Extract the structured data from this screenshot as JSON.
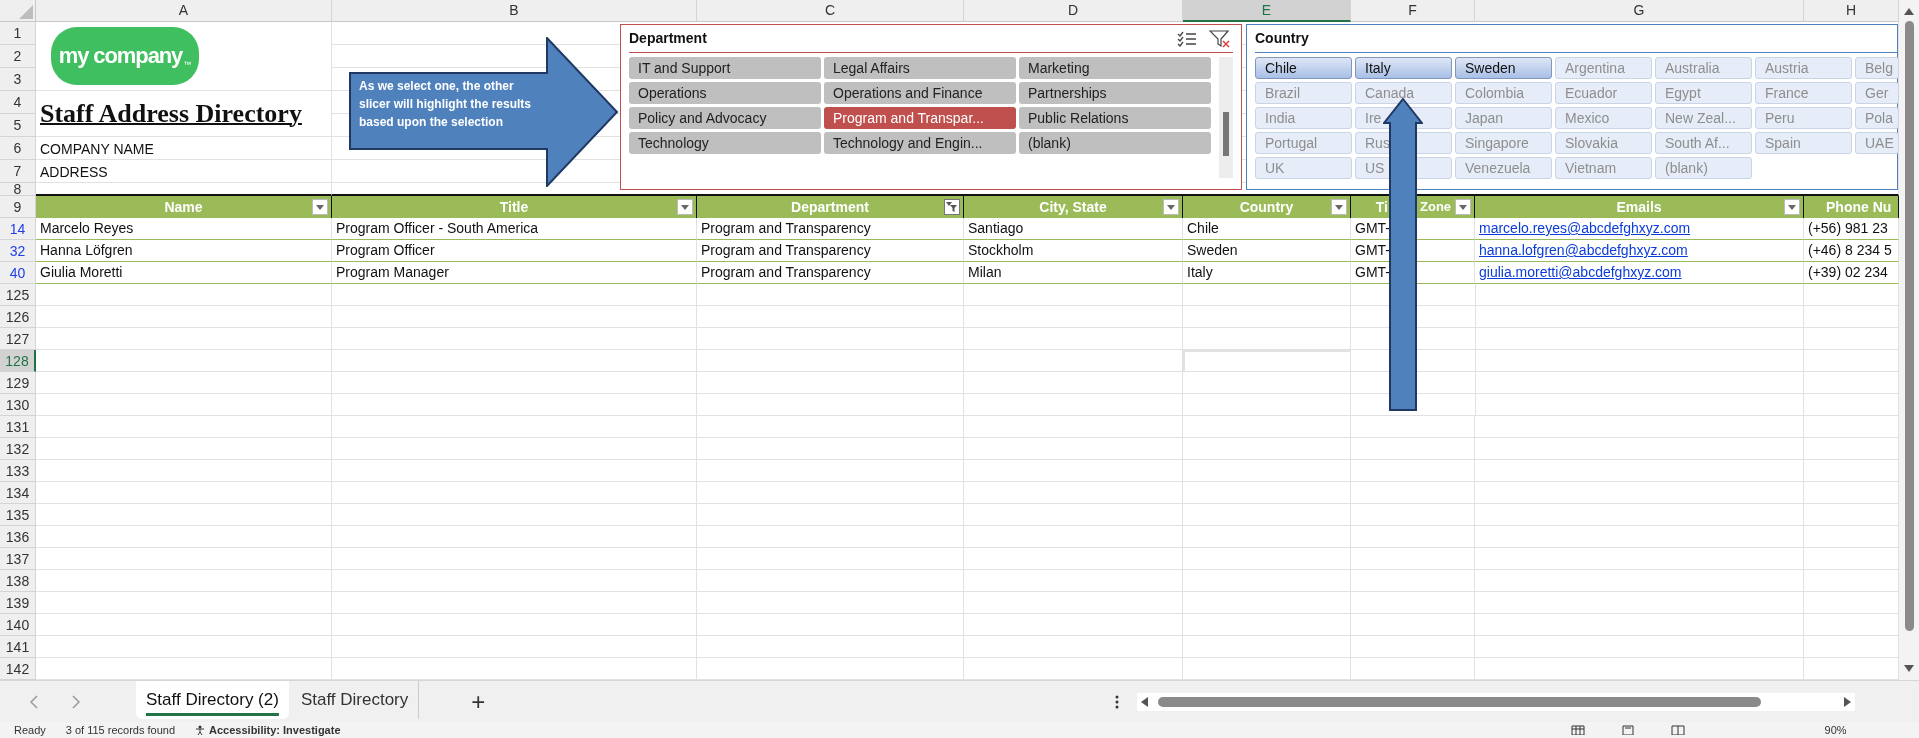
{
  "sheet": {
    "column_headers": [
      {
        "label": "A",
        "selected": false
      },
      {
        "label": "B",
        "selected": false
      },
      {
        "label": "C",
        "selected": false
      },
      {
        "label": "D",
        "selected": false
      },
      {
        "label": "E",
        "selected": true
      },
      {
        "label": "F",
        "selected": false
      },
      {
        "label": "G",
        "selected": false
      },
      {
        "label": "H",
        "selected": false
      }
    ],
    "top_rows": [
      "1",
      "2",
      "3",
      "4",
      "5",
      "6",
      "7",
      "8"
    ],
    "title": "Staff Address Directory",
    "company_name": "COMPANY NAME",
    "address": "ADDRESS",
    "logo": {
      "text": "my company",
      "mark": "™"
    },
    "table": {
      "row": "9",
      "columns": [
        {
          "label": "Name",
          "filtered": false,
          "button_visible": true,
          "kind": "text"
        },
        {
          "label": "Title",
          "filtered": false,
          "button_visible": true,
          "kind": "text"
        },
        {
          "label": "Department",
          "filtered": true,
          "button_visible": true,
          "kind": "text"
        },
        {
          "label": "City, State",
          "filtered": false,
          "button_visible": true,
          "kind": "text"
        },
        {
          "label": "Country",
          "filtered": false,
          "button_visible": true,
          "kind": "text"
        },
        {
          "label_parts": [
            "Ti",
            "Zone"
          ],
          "filtered": false,
          "button_visible": true,
          "kind": "text"
        },
        {
          "label": "Emails",
          "filtered": false,
          "button_visible": true,
          "kind": "link"
        },
        {
          "label": "Phone Nu",
          "button_visible": false,
          "kind": "text"
        }
      ],
      "rows": [
        {
          "row": "14",
          "cells": [
            "Marcelo Reyes",
            "Program Officer - South America",
            "Program and Transparency",
            "Santiago",
            "Chile",
            "GMT-",
            "marcelo.reyes@abcdefghxyz.com",
            "(+56) 981 23"
          ]
        },
        {
          "row": "32",
          "cells": [
            "Hanna Löfgren",
            "Program Officer",
            "Program and Transparency",
            "Stockholm",
            "Sweden",
            "GMT-",
            "hanna.lofgren@abcdefghxyz.com",
            "(+46) 8 234 5"
          ]
        },
        {
          "row": "40",
          "cells": [
            "Giulia Moretti",
            "Program Manager",
            "Program and Transparency",
            "Milan",
            "Italy",
            "GMT-",
            "giulia.moretti@abcdefghxyz.com",
            "(+39) 02 234"
          ]
        }
      ]
    },
    "empty_rows": [
      {
        "row": "125",
        "selected": false
      },
      {
        "row": "126",
        "selected": false
      },
      {
        "row": "127",
        "selected": false
      },
      {
        "row": "128",
        "selected": true
      },
      {
        "row": "129",
        "selected": false
      },
      {
        "row": "130",
        "selected": false
      },
      {
        "row": "131",
        "selected": false
      },
      {
        "row": "132",
        "selected": false
      },
      {
        "row": "133",
        "selected": false
      },
      {
        "row": "134",
        "selected": false
      },
      {
        "row": "135",
        "selected": false
      },
      {
        "row": "136",
        "selected": false
      },
      {
        "row": "137",
        "selected": false
      },
      {
        "row": "138",
        "selected": false
      },
      {
        "row": "139",
        "selected": false
      },
      {
        "row": "140",
        "selected": false
      },
      {
        "row": "141",
        "selected": false
      },
      {
        "row": "142",
        "selected": false
      }
    ]
  },
  "callout": {
    "text": "As we select one, the other slicer will highlight the results based upon the selection"
  },
  "department_slicer": {
    "title": "Department",
    "items": [
      {
        "label": "IT and Support",
        "selected": false
      },
      {
        "label": "Legal Affairs",
        "selected": false
      },
      {
        "label": "Marketing",
        "selected": false
      },
      {
        "label": "Operations",
        "selected": false
      },
      {
        "label": "Operations and Finance",
        "selected": false
      },
      {
        "label": "Partnerships",
        "selected": false
      },
      {
        "label": "Policy and Advocacy",
        "selected": false
      },
      {
        "label": "Program and Transpar...",
        "selected": true
      },
      {
        "label": "Public Relations",
        "selected": false
      },
      {
        "label": "Technology",
        "selected": false
      },
      {
        "label": "Technology and Engin...",
        "selected": false
      },
      {
        "label": "(blank)",
        "selected": false
      }
    ]
  },
  "country_slicer": {
    "title": "Country",
    "items": [
      {
        "label": "Chile",
        "has_data": true
      },
      {
        "label": "Italy",
        "has_data": true
      },
      {
        "label": "Sweden",
        "has_data": true
      },
      {
        "label": "Argentina",
        "has_data": false
      },
      {
        "label": "Australia",
        "has_data": false
      },
      {
        "label": "Austria",
        "has_data": false
      },
      {
        "label": "Belg",
        "has_data": false
      },
      {
        "label": "Brazil",
        "has_data": false
      },
      {
        "label": "Canada",
        "has_data": false
      },
      {
        "label": "Colombia",
        "has_data": false
      },
      {
        "label": "Ecuador",
        "has_data": false
      },
      {
        "label": "Egypt",
        "has_data": false
      },
      {
        "label": "France",
        "has_data": false
      },
      {
        "label": "Ger",
        "has_data": false
      },
      {
        "label": "India",
        "has_data": false
      },
      {
        "label": "Ire",
        "has_data": false
      },
      {
        "label": "Japan",
        "has_data": false
      },
      {
        "label": "Mexico",
        "has_data": false
      },
      {
        "label": "New Zeal...",
        "has_data": false
      },
      {
        "label": "Peru",
        "has_data": false
      },
      {
        "label": "Pola",
        "has_data": false
      },
      {
        "label": "Portugal",
        "has_data": false
      },
      {
        "label": "Rus",
        "has_data": false
      },
      {
        "label": "Singapore",
        "has_data": false
      },
      {
        "label": "Slovakia",
        "has_data": false
      },
      {
        "label": "South Af...",
        "has_data": false
      },
      {
        "label": "Spain",
        "has_data": false
      },
      {
        "label": "UAE",
        "has_data": false
      },
      {
        "label": "UK",
        "has_data": false
      },
      {
        "label": "US",
        "has_data": false
      },
      {
        "label": "Venezuela",
        "has_data": false
      },
      {
        "label": "Vietnam",
        "has_data": false
      },
      {
        "label": "(blank)",
        "has_data": false
      }
    ]
  },
  "sheet_tabs": [
    {
      "label": "Staff Directory (2)",
      "selected": true
    },
    {
      "label": "Staff Directory",
      "selected": false
    }
  ],
  "new_sheet": "+",
  "status_bar": {
    "mode": "Ready",
    "records": "3 of 115 records found",
    "accessibility": "Accessibility: Investigate",
    "zoom": "90%"
  }
}
